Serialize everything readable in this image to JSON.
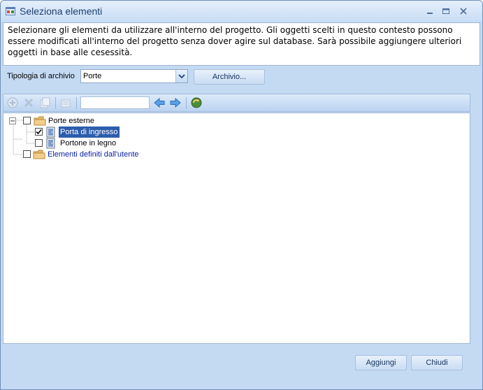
{
  "window": {
    "title": "Seleziona elementi",
    "controls": [
      "minimize-icon",
      "maximize-icon",
      "close-icon"
    ]
  },
  "description": "Selezionare gli elementi da utilizzare all'interno del progetto. Gli oggetti scelti in questo contesto possono essere modificati all'interno del progetto senza dover agire sul database. Sarà possibile aggiungere ulteriori oggetti in base alle cesessità.",
  "filter": {
    "label": "Tipologia di archivio",
    "selected": "Porte",
    "archive_button": "Archivio..."
  },
  "toolbar": {
    "icons": [
      "add-icon",
      "delete-icon",
      "copy-icon",
      "properties-icon",
      "back-arrow-icon",
      "forward-arrow-icon",
      "refresh-icon"
    ],
    "search_value": ""
  },
  "tree": {
    "root": {
      "label": "Porte esterne",
      "checked": false,
      "expanded": true
    },
    "children": [
      {
        "label": "Porta di ingresso",
        "checked": true,
        "selected": true
      },
      {
        "label": "Portone in legno",
        "checked": false,
        "selected": false
      }
    ],
    "user_node": {
      "label": "Elementi definiti dall'utente",
      "checked": false
    }
  },
  "footer": {
    "add_button": "Aggiungi",
    "close_button": "Chiudi"
  },
  "colors": {
    "window_bg": "#c4daf3",
    "selection": "#2c5dad",
    "user_node_text": "#0b22a3",
    "title_text": "#1e3f6f"
  }
}
